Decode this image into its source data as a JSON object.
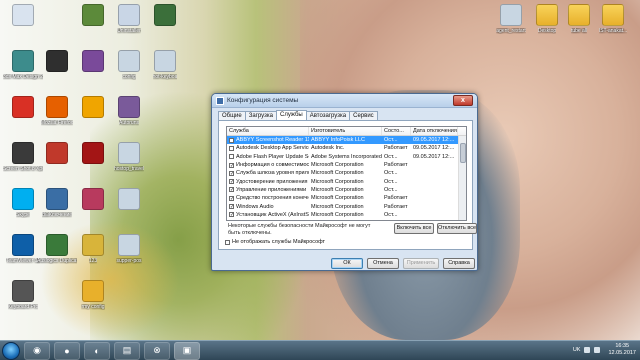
{
  "desktop": {
    "icons": [
      {
        "label": "",
        "color": "#d9e3ef"
      },
      {
        "label": "",
        "color": "#5c8a3a"
      },
      {
        "label": "Uninstaller",
        "color": "#c9d6e6"
      },
      {
        "label": "",
        "color": "#3b6f3a"
      },
      {
        "label": "3ds Max Design 2015",
        "color": "#3d8c8c"
      },
      {
        "label": "",
        "color": "#2f2f2f"
      },
      {
        "label": "",
        "color": "#7a4a9a"
      },
      {
        "label": "config",
        "color": "#c8d6e2"
      },
      {
        "label": "hot-keyboa",
        "color": "#c8d6e2"
      },
      {
        "label": "",
        "color": "#d93025"
      },
      {
        "label": "Mozilla Firefox",
        "color": "#e66000"
      },
      {
        "label": "",
        "color": "#f0a500"
      },
      {
        "label": "Autoruns",
        "color": "#7a5a9a"
      },
      {
        "label": "Screen Shot 8 Хром",
        "color": "#3a3a3a"
      },
      {
        "label": "",
        "color": "#c0392b"
      },
      {
        "label": "",
        "color": "#a31515"
      },
      {
        "label": "hostop_travel",
        "color": "#c8d6e2"
      },
      {
        "label": "Skype",
        "color": "#00aff0"
      },
      {
        "label": "ВыКлючение",
        "color": "#3a6ea5"
      },
      {
        "label": "",
        "color": "#b83a5e"
      },
      {
        "label": "",
        "color": "#c8d6e2"
      },
      {
        "label": "TeamViewer 12",
        "color": "#0e5fa8"
      },
      {
        "label": "Auslogics Duplicate Fi",
        "color": "#3a7a3a"
      },
      {
        "label": "123",
        "color": "#d8b43a"
      },
      {
        "label": "supper-pos",
        "color": "#c8d6e2"
      },
      {
        "label": "Keyboard Pro",
        "color": "#555"
      },
      {
        "label": "rmy config",
        "color": "#e8b02b"
      }
    ],
    "right_icons": [
      {
        "label": "agent_restart",
        "color": "#c8d6e2"
      },
      {
        "label": "Desktop",
        "color": "#e8b02b"
      },
      {
        "label": "tube all",
        "color": "#e8b02b"
      },
      {
        "label": "IST-anakat...",
        "color": "#e8b02b"
      }
    ]
  },
  "dialog": {
    "title": "Конфигурация системы",
    "close_label": "x",
    "tabs": [
      "Общие",
      "Загрузка",
      "Службы",
      "Автозагрузка",
      "Сервис"
    ],
    "active_tab": 2,
    "columns": [
      "Служба",
      "Изготовитель",
      "Состо...",
      "Дата отключения"
    ],
    "rows": [
      {
        "checked": false,
        "selected": true,
        "service": "ABBYY Screenshot Reader 11 - ...",
        "maker": "ABBYY InfoPoisk LLC",
        "state": "Ост...",
        "date": "09.05.2017 12:..."
      },
      {
        "checked": false,
        "selected": false,
        "service": "Autodesk Desktop App Service",
        "maker": "Autodesk Inc.",
        "state": "Работает",
        "date": "09.05.2017 12:..."
      },
      {
        "checked": false,
        "selected": false,
        "service": "Adobe Flash Player Update Service",
        "maker": "Adobe Systems Incorporated",
        "state": "Ост...",
        "date": "09.05.2017 12:..."
      },
      {
        "checked": true,
        "selected": false,
        "service": "Информация о совместимости п...",
        "maker": "Microsoft Corporation",
        "state": "Работает",
        "date": ""
      },
      {
        "checked": true,
        "selected": false,
        "service": "Служба шлюза уровня приложе...",
        "maker": "Microsoft Corporation",
        "state": "Ост...",
        "date": ""
      },
      {
        "checked": true,
        "selected": false,
        "service": "Удостоверение приложения",
        "maker": "Microsoft Corporation",
        "state": "Ост...",
        "date": ""
      },
      {
        "checked": true,
        "selected": false,
        "service": "Управление приложениями",
        "maker": "Microsoft Corporation",
        "state": "Ост...",
        "date": ""
      },
      {
        "checked": true,
        "selected": false,
        "service": "Средство построения конечн...",
        "maker": "Microsoft Corporation",
        "state": "Работает",
        "date": ""
      },
      {
        "checked": true,
        "selected": false,
        "service": "Windows Audio",
        "maker": "Microsoft Corporation",
        "state": "Работает",
        "date": ""
      },
      {
        "checked": true,
        "selected": false,
        "service": "Установщик ActiveX (AxInstSV)",
        "maker": "Microsoft Corporation",
        "state": "Ост...",
        "date": ""
      }
    ],
    "partial_row": {
      "checked": true,
      "service": "Служба шифрования дисков Bi...",
      "maker": "Microsoft Corporation",
      "state": "Работает"
    },
    "note": "Некоторые службы безопасности Майкрософт не могут быть отключены.",
    "enable_all": "Включить все",
    "disable_all": "Отключить все",
    "hide_ms": "Не отображать службы Майкрософт",
    "ok": "ОК",
    "cancel": "Отмена",
    "apply": "Применить",
    "help": "Справка"
  },
  "taskbar": {
    "items": [
      "◉",
      "●",
      "◐",
      "▤",
      "⊗",
      "▣"
    ],
    "lang": "UK",
    "time": "16:35",
    "date": "12.05.2017"
  }
}
